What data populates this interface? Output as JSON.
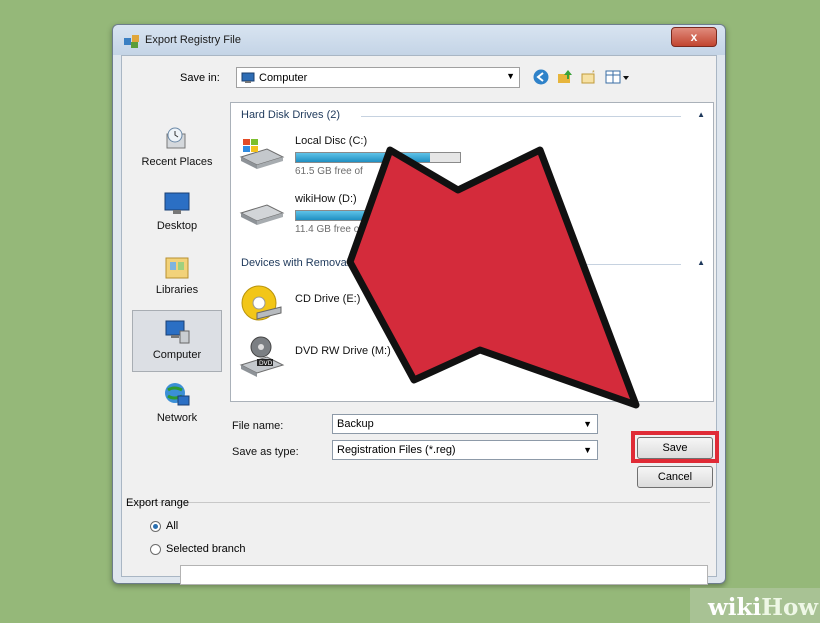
{
  "window": {
    "title": "Export Registry File",
    "close_label": "x"
  },
  "toolbar": {
    "save_in_label": "Save in:",
    "save_in_value": "Computer"
  },
  "places": [
    {
      "label": "Recent Places",
      "icon": "recent-places-icon"
    },
    {
      "label": "Desktop",
      "icon": "desktop-icon"
    },
    {
      "label": "Libraries",
      "icon": "libraries-icon"
    },
    {
      "label": "Computer",
      "icon": "computer-icon",
      "selected": true
    },
    {
      "label": "Network",
      "icon": "network-icon"
    }
  ],
  "groups": {
    "hdd": {
      "title": "Hard Disk Drives (2)"
    },
    "removable": {
      "title": "Devices with Removable Storage (2)"
    }
  },
  "drives": [
    {
      "name": "Local Disc (C:)",
      "free": "61.5 GB free of",
      "fill": 0.82
    },
    {
      "name": "wikiHow (D:)",
      "free": "11.4 GB free of 104 GB",
      "fill": 0.89
    }
  ],
  "removable": [
    {
      "name": "CD Drive (E:)",
      "icon": "cd-drive-icon"
    },
    {
      "name": "DVD RW Drive (M:)",
      "icon": "dvd-drive-icon"
    }
  ],
  "form": {
    "file_name_label": "File name:",
    "file_name_value": "Backup",
    "save_type_label": "Save as type:",
    "save_type_value": "Registration Files (*.reg)",
    "save_button": "Save",
    "cancel_button": "Cancel"
  },
  "export_range": {
    "title": "Export range",
    "all_label": "All",
    "selected_label": "Selected branch",
    "selected": "All"
  },
  "watermark": {
    "wiki": "wiki",
    "how": "How"
  },
  "colors": {
    "highlight": "#e02b36",
    "arrow": "#d42b3b",
    "accent": "#1e395b"
  }
}
